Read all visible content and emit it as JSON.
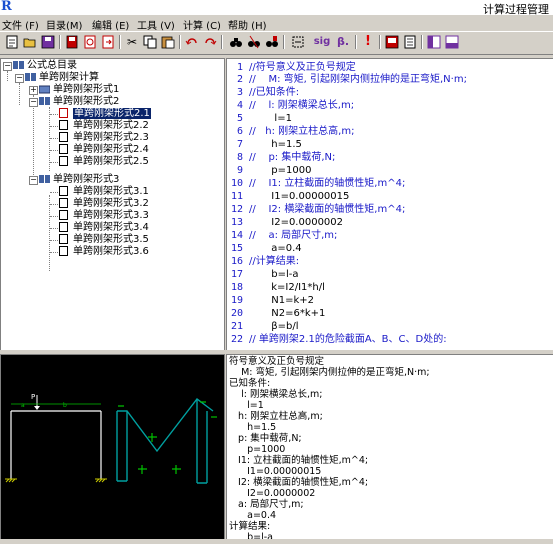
{
  "window": {
    "title": "计算过程管理",
    "logo": "R"
  },
  "menu": [
    {
      "label": "文件 (F)"
    },
    {
      "label": "目录(M)"
    },
    {
      "label": "编辑 (E)"
    },
    {
      "label": "工具 (V)"
    },
    {
      "label": "计算 (C)"
    },
    {
      "label": "帮助 (H)"
    }
  ],
  "toolbar": {
    "sig_label": "sig",
    "beta_label": "β.",
    "bang_label": "!"
  },
  "tree": {
    "root": "公式总目录",
    "level1": "单跨刚架计算",
    "forms": [
      {
        "label": "单跨刚架形式1"
      },
      {
        "label": "单跨刚架形式2"
      },
      {
        "label": "单跨刚架形式3"
      }
    ],
    "form2_items": [
      "单跨刚架形式2.1",
      "单跨刚架形式2.2",
      "单跨刚架形式2.3",
      "单跨刚架形式2.4",
      "单跨刚架形式2.5"
    ],
    "form3_items": [
      "单跨刚架形式3.1",
      "单跨刚架形式3.2",
      "单跨刚架形式3.3",
      "单跨刚架形式3.4",
      "单跨刚架形式3.5",
      "单跨刚架形式3.6"
    ]
  },
  "editor": {
    "line_numbers": [
      "1",
      "2",
      "3",
      "4",
      "5",
      "6",
      "7",
      "8",
      "9",
      "10",
      "11",
      "12",
      "13",
      "14",
      "15",
      "16",
      "17",
      "18",
      "19",
      "20",
      "21",
      "22"
    ],
    "lines": [
      {
        "t": "//符号意义及正负号规定",
        "k": "c-cmt"
      },
      {
        "t": "//    M: 弯矩, 引起刚架内侧拉伸的是正弯矩,N·m;",
        "k": "c-cmt"
      },
      {
        "t": "//已知条件:",
        "k": "c-cmt"
      },
      {
        "t": "//    l: 刚架横梁总长,m;",
        "k": "c-cmt"
      },
      {
        "t": "        l=1",
        "k": "c-code"
      },
      {
        "t": "//   h: 刚架立柱总高,m;",
        "k": "c-cmt"
      },
      {
        "t": "       h=1.5",
        "k": "c-code"
      },
      {
        "t": "//    p: 集中载荷,N;",
        "k": "c-cmt"
      },
      {
        "t": "       p=1000",
        "k": "c-code"
      },
      {
        "t": "//    I1: 立柱截面的轴惯性矩,m^4;",
        "k": "c-cmt"
      },
      {
        "t": "       I1=0.00000015",
        "k": "c-code"
      },
      {
        "t": "//    I2: 横梁截面的轴惯性矩,m^4;",
        "k": "c-cmt"
      },
      {
        "t": "       I2=0.0000002",
        "k": "c-code"
      },
      {
        "t": "//    a: 局部尺寸,m;",
        "k": "c-cmt"
      },
      {
        "t": "       a=0.4",
        "k": "c-code"
      },
      {
        "t": "//计算结果:",
        "k": "c-cmt"
      },
      {
        "t": "       b=l-a",
        "k": "c-code"
      },
      {
        "t": "       k=I2/I1*h/l",
        "k": "c-code"
      },
      {
        "t": "       N1=k+2",
        "k": "c-code"
      },
      {
        "t": "       N2=6*k+1",
        "k": "c-code"
      },
      {
        "t": "       β=b/l",
        "k": "c-code"
      },
      {
        "t": "// 单跨刚架2.1的危险截面A、B、C、D处的:",
        "k": "c-cmt"
      }
    ]
  },
  "output": {
    "lines": [
      "符号意义及正负号规定",
      "    M: 弯矩, 引起刚架内侧拉伸的是正弯矩,N·m;",
      "已知条件:",
      "    l: 刚架横梁总长,m;",
      "      l=1",
      "   h: 刚架立柱总高,m;",
      "      h=1.5",
      "   p: 集中载荷,N;",
      "      p=1000",
      "   I1: 立柱截面的轴惯性矩,m^4;",
      "      I1=0.00000015",
      "   I2: 横梁截面的轴惯性矩,m^4;",
      "      I2=0.0000002",
      "   a: 局部尺寸,m;",
      "      a=0.4",
      "计算结果:",
      "      b=l-a"
    ]
  },
  "diagram": {
    "load_label": "P",
    "dim_a": "a",
    "dim_b": "b"
  },
  "colors": {
    "comment": "#1a1ac8",
    "selection": "#0a246a",
    "moment": "#00c000",
    "frame": "#ffffff"
  }
}
